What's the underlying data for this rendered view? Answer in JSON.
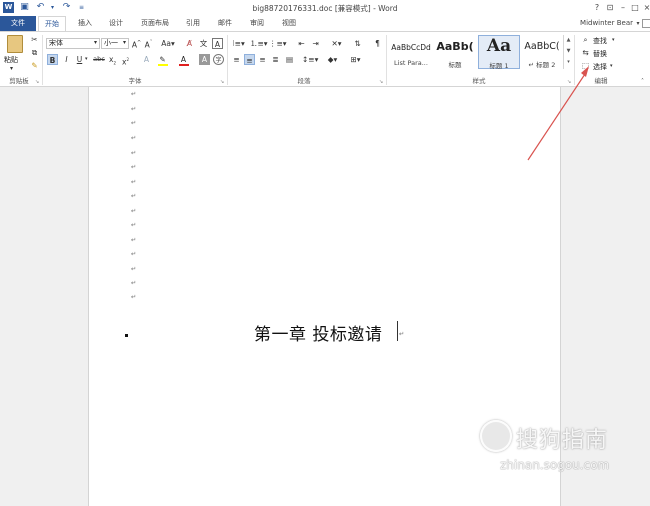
{
  "titlebar": {
    "title": "big88720176331.doc [兼容模式] - Word",
    "help": "?",
    "minimize": "–",
    "restore": "□",
    "close": "×"
  },
  "tabs": {
    "file": "文件",
    "home": "开始",
    "insert": "插入",
    "design": "设计",
    "layout": "页面布局",
    "references": "引用",
    "mailings": "邮件",
    "review": "审阅",
    "view": "视图",
    "user": "Midwinter Bear"
  },
  "clipboard": {
    "paste": "粘贴",
    "label": "剪贴板"
  },
  "font": {
    "name": "宋体",
    "size": "小一",
    "label": "字体"
  },
  "paragraph": {
    "label": "段落"
  },
  "styles": {
    "label": "样式",
    "items": [
      {
        "sample": "AaBbCcDd",
        "name": "List Para..."
      },
      {
        "sample": "AaBb(",
        "name": "标题"
      },
      {
        "sample": "Aa",
        "name": "标题 1"
      },
      {
        "sample": "AaBbC(",
        "name": "↵ 标题 2"
      }
    ]
  },
  "editing": {
    "find": "查找",
    "replace": "替换",
    "select": "选择",
    "label": "编辑"
  },
  "document": {
    "heading": "第一章  投标邀请",
    "paragraph_mark": "↵"
  },
  "watermark": {
    "text": "搜狗指南",
    "url": "zhinan.sogou.com"
  },
  "colors": {
    "accent": "#2b579a",
    "arrow": "#d9534f"
  }
}
